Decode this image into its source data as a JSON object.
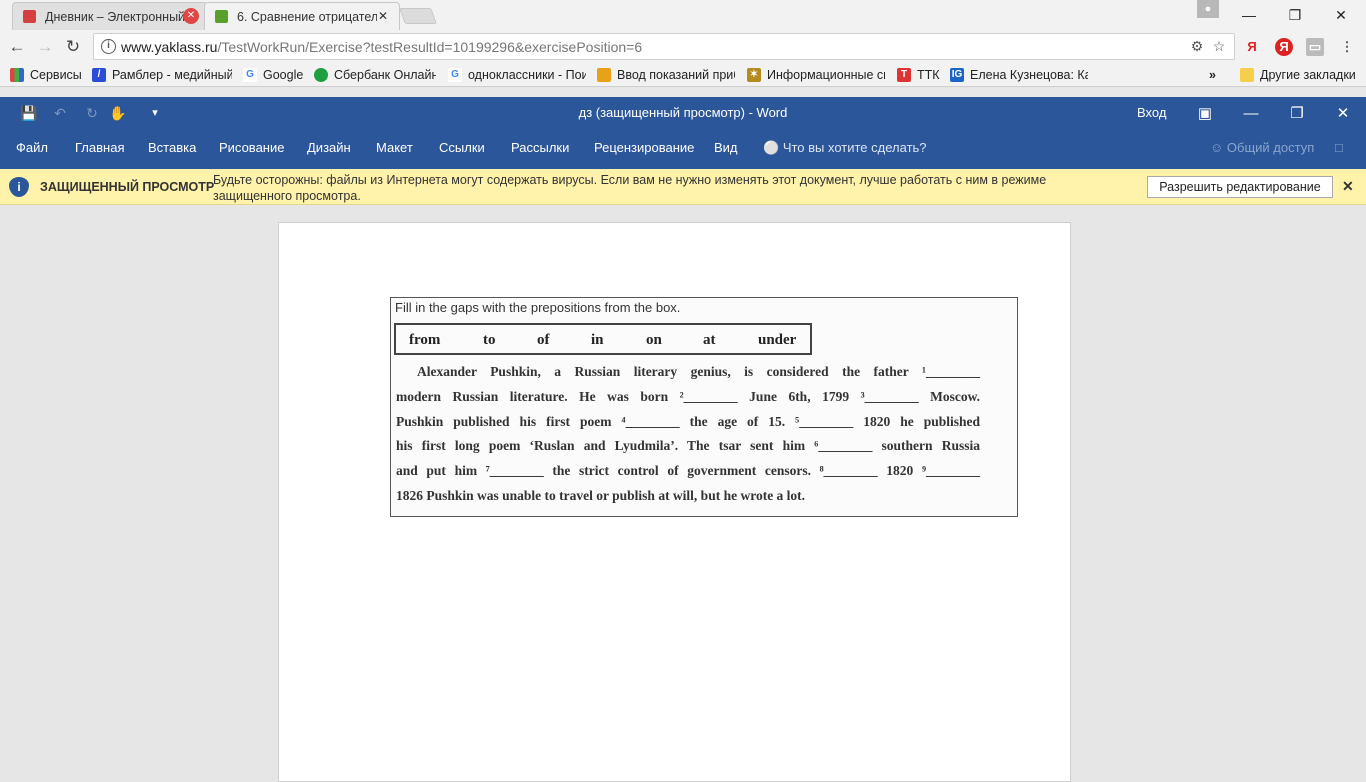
{
  "browser": {
    "tabs": [
      {
        "title": "Дневник – Электронный",
        "active": false,
        "favicon_color": "#d43f3f"
      },
      {
        "title": "6. Сравнение отрицател",
        "active": true,
        "favicon_color": "#5aa02c"
      }
    ],
    "tab_close": "✕",
    "url_host": "www.yaklass.ru",
    "url_path": "/TestWorkRun/Exercise?testResultId=10199296&exercisePosition=6",
    "extensions": [
      "Я",
      "Я"
    ],
    "bookmarks": [
      {
        "label": "Сервисы",
        "icon": "apps-icon",
        "color": "#d44"
      },
      {
        "label": "Рамблер - медийный",
        "icon": "rambler-icon",
        "color": "#2a4fd6"
      },
      {
        "label": "Google",
        "icon": "google-icon",
        "color": "#4285f4"
      },
      {
        "label": "Сбербанк Онлайн",
        "icon": "sberbank-icon",
        "color": "#1fa040"
      },
      {
        "label": "одноклассники - Пои",
        "icon": "google-icon",
        "color": "#4285f4"
      },
      {
        "label": "Ввод показаний прибо",
        "icon": "meter-icon",
        "color": "#e8a21a"
      },
      {
        "label": "Информационные си",
        "icon": "emblem-icon",
        "color": "#b58b1f"
      },
      {
        "label": "ТТК",
        "icon": "ttk-icon",
        "color": "#d33"
      },
      {
        "label": "Елена Кузнецова: Ка",
        "icon": "ig-icon",
        "color": "#1b64c8"
      }
    ],
    "bookmarks_more": "»",
    "other_bookmarks": "Другие закладки"
  },
  "word": {
    "title": "дз (защищенный просмотр)  -  Word",
    "signin": "Вход",
    "menu": [
      "Файл",
      "Главная",
      "Вставка",
      "Рисование",
      "Дизайн",
      "Макет",
      "Ссылки",
      "Рассылки",
      "Рецензирование",
      "Вид"
    ],
    "tell_me": "Что вы хотите сделать?",
    "share": "Общий доступ",
    "accent_color": "#2b579a"
  },
  "protected_view": {
    "label": "ЗАЩИЩЕННЫЙ ПРОСМОТР",
    "message": "Будьте осторожны: файлы из Интернета могут содержать вирусы. Если вам не нужно изменять этот документ, лучше работать с ним в режиме защищенного просмотра.",
    "enable_button": "Разрешить редактирование",
    "close": "✕"
  },
  "document": {
    "instruction": "Fill in the gaps with the prepositions from the box.",
    "word_box": [
      "from",
      "to",
      "of",
      "in",
      "on",
      "at",
      "under"
    ],
    "lines": [
      "Alexander Pushkin, a Russian literary genius, is considered the father ¹________",
      "modern Russian literature. He was born ²________ June 6th, 1799 ³________ Moscow.",
      "Pushkin published his first poem ⁴________ the age of 15. ⁵________ 1820 he published",
      "his first long poem ‘Ruslan and Lyudmila’. The tsar sent him ⁶________ southern Russia",
      "and put him ⁷________ the strict control of government censors. ⁸________ 1820 ⁹________",
      "1826 Pushkin was unable to travel or publish at will, but he wrote a lot."
    ]
  }
}
